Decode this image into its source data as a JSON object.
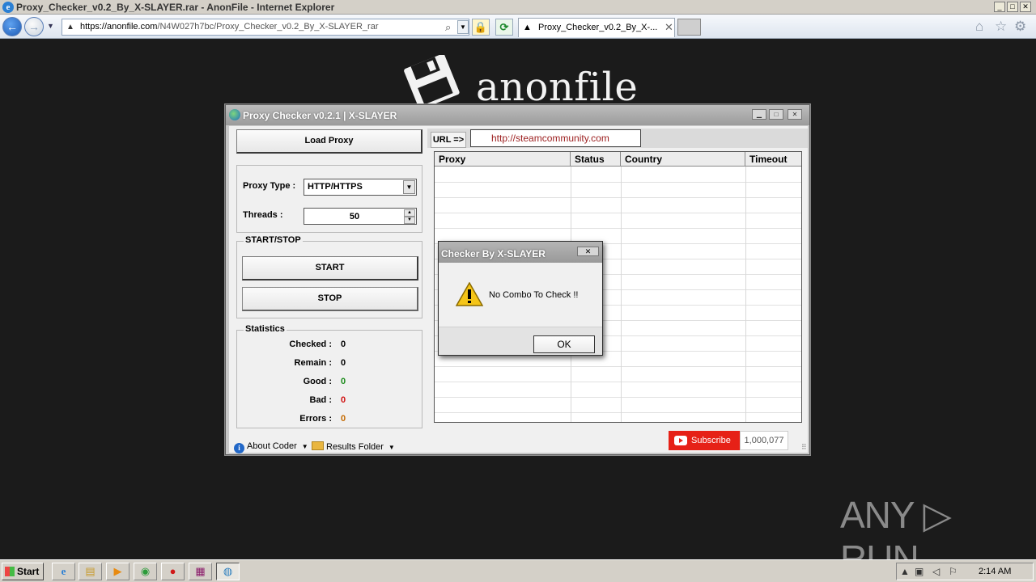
{
  "browser": {
    "title": "Proxy_Checker_v0.2_By_X-SLAYER.rar - AnonFile - Internet Explorer",
    "address_host": "https://anonfile.com",
    "address_path": "/N4W027h7bc/Proxy_Checker_v0.2_By_X-SLAYER_rar",
    "tab_title": "Proxy_Checker_v0.2_By_X-...",
    "icons": [
      "back-icon",
      "forward-icon",
      "lock-icon",
      "refresh-icon",
      "home-icon",
      "favorites-icon",
      "tools-icon"
    ]
  },
  "site": {
    "logo_text": "anonfile"
  },
  "app": {
    "title": "Proxy Checker v0.2.1 | X-SLAYER",
    "load_proxy_label": "Load Proxy",
    "proxy_type_label": "Proxy Type :",
    "proxy_type_value": "HTTP/HTTPS",
    "threads_label": "Threads :",
    "threads_value": "50",
    "startstop_title": "START/STOP",
    "start_label": "START",
    "stop_label": "STOP",
    "stats_title": "Statistics",
    "stats": [
      {
        "label": "Checked :",
        "value": "0",
        "color": "#000000"
      },
      {
        "label": "Remain :",
        "value": "0",
        "color": "#000000"
      },
      {
        "label": "Good :",
        "value": "0",
        "color": "#1a8a1a"
      },
      {
        "label": "Bad :",
        "value": "0",
        "color": "#d01010"
      },
      {
        "label": "Errors :",
        "value": "0",
        "color": "#c46a00"
      }
    ],
    "url_label": "URL =>",
    "url_value": "http://steamcommunity.com",
    "table_columns": [
      "Proxy",
      "Status",
      "Country",
      "Timeout"
    ],
    "about_label": "About Coder",
    "results_label": "Results Folder",
    "subscribe_label": "Subscribe",
    "subscribe_count": "1,000,077"
  },
  "dialog": {
    "title": "Checker By X-SLAYER",
    "message": "No Combo To Check !!",
    "ok_label": "OK"
  },
  "watermark": "ANY ▷ RUN",
  "taskbar": {
    "start_label": "Start",
    "clock": "2:14 AM"
  },
  "colors": {
    "accent_red": "#e62117",
    "url_text": "#9b1c1c"
  }
}
